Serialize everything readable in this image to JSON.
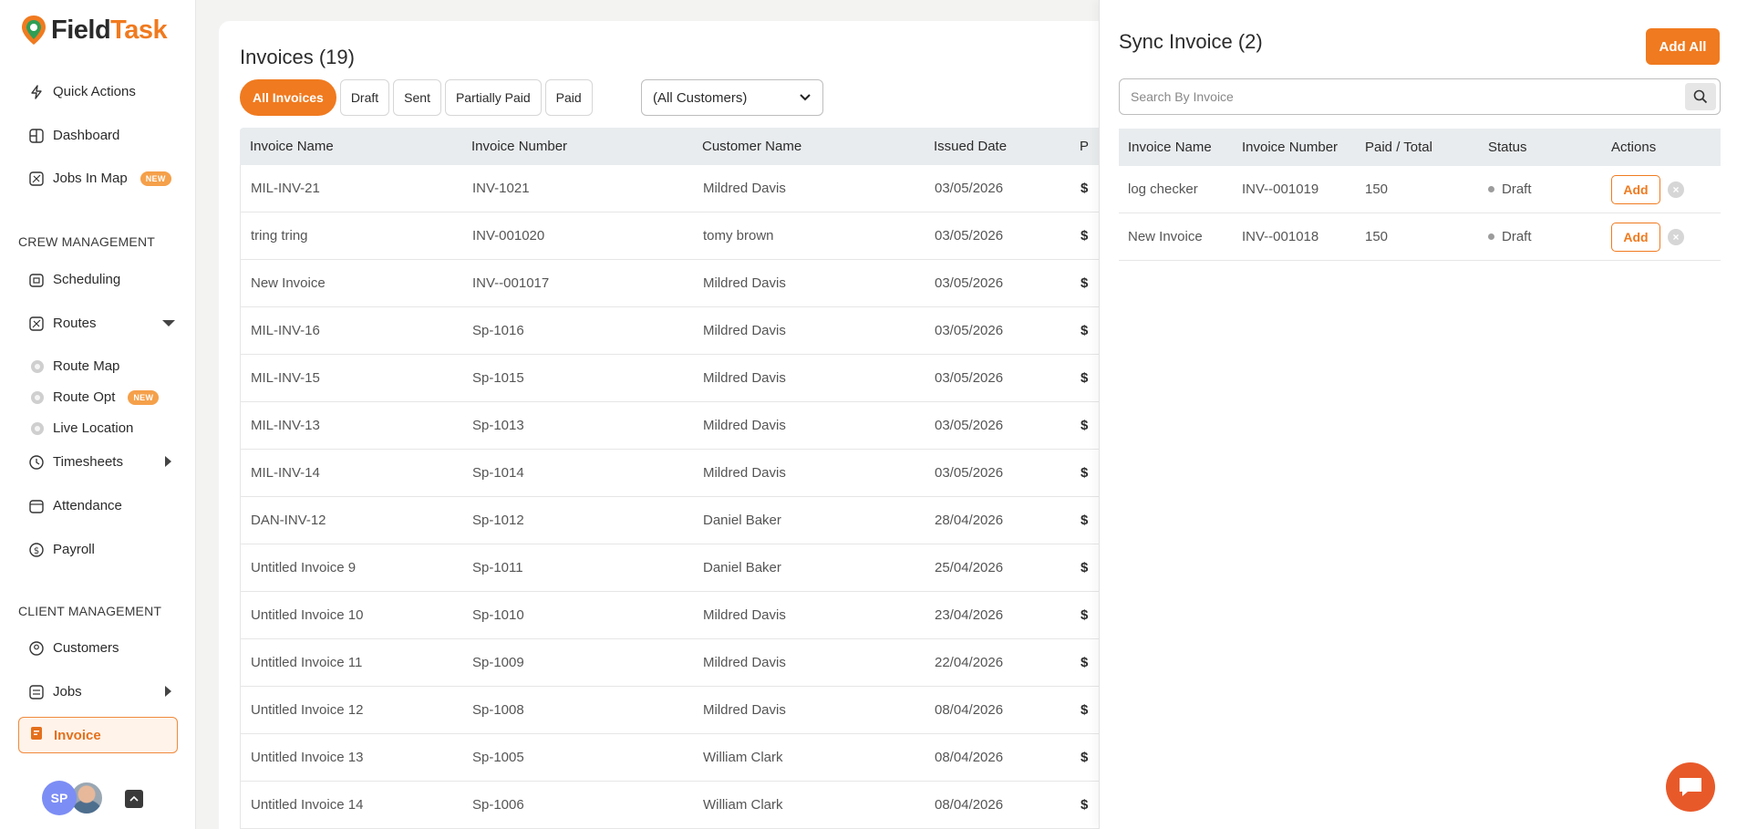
{
  "app": {
    "logo_part1": "Field",
    "logo_part2": "Task"
  },
  "sidebar": {
    "quick_actions": "Quick Actions",
    "dashboard": "Dashboard",
    "jobs_in_map": "Jobs In Map",
    "new_badge": "NEW",
    "crew_section": "CREW MANAGEMENT",
    "scheduling": "Scheduling",
    "routes": "Routes",
    "route_map": "Route Map",
    "route_opt": "Route Opt",
    "live_location": "Live Location",
    "timesheets": "Timesheets",
    "attendance": "Attendance",
    "payroll": "Payroll",
    "client_section": "CLIENT MANAGEMENT",
    "customers": "Customers",
    "jobs": "Jobs",
    "invoice": "Invoice",
    "avatar_initials": "SP"
  },
  "main": {
    "title": "Invoices (19)",
    "filters": [
      "All Invoices",
      "Draft",
      "Sent",
      "Partially Paid",
      "Paid"
    ],
    "customer_select": "(All Customers)",
    "columns": [
      "Invoice Name",
      "Invoice Number",
      "Customer Name",
      "Issued Date",
      "P"
    ],
    "rows": [
      {
        "name": "MIL-INV-21",
        "number": "INV-1021",
        "customer": "Mildred Davis",
        "date": "03/05/2026",
        "paid": "$"
      },
      {
        "name": "tring tring",
        "number": "INV-001020",
        "customer": "tomy brown",
        "date": "03/05/2026",
        "paid": "$"
      },
      {
        "name": "New Invoice",
        "number": "INV--001017",
        "customer": "Mildred Davis",
        "date": "03/05/2026",
        "paid": "$"
      },
      {
        "name": "MIL-INV-16",
        "number": "Sp-1016",
        "customer": "Mildred Davis",
        "date": "03/05/2026",
        "paid": "$"
      },
      {
        "name": "MIL-INV-15",
        "number": "Sp-1015",
        "customer": "Mildred Davis",
        "date": "03/05/2026",
        "paid": "$"
      },
      {
        "name": "MIL-INV-13",
        "number": "Sp-1013",
        "customer": "Mildred Davis",
        "date": "03/05/2026",
        "paid": "$"
      },
      {
        "name": "MIL-INV-14",
        "number": "Sp-1014",
        "customer": "Mildred Davis",
        "date": "03/05/2026",
        "paid": "$"
      },
      {
        "name": "DAN-INV-12",
        "number": "Sp-1012",
        "customer": "Daniel Baker",
        "date": "28/04/2026",
        "paid": "$"
      },
      {
        "name": "Untitled Invoice 9",
        "number": "Sp-1011",
        "customer": "Daniel Baker",
        "date": "25/04/2026",
        "paid": "$"
      },
      {
        "name": "Untitled Invoice 10",
        "number": "Sp-1010",
        "customer": "Mildred Davis",
        "date": "23/04/2026",
        "paid": "$"
      },
      {
        "name": "Untitled Invoice 11",
        "number": "Sp-1009",
        "customer": "Mildred Davis",
        "date": "22/04/2026",
        "paid": "$"
      },
      {
        "name": "Untitled Invoice 12",
        "number": "Sp-1008",
        "customer": "Mildred Davis",
        "date": "08/04/2026",
        "paid": "$"
      },
      {
        "name": "Untitled Invoice 13",
        "number": "Sp-1005",
        "customer": "William Clark",
        "date": "08/04/2026",
        "paid": "$"
      },
      {
        "name": "Untitled Invoice 14",
        "number": "Sp-1006",
        "customer": "William Clark",
        "date": "08/04/2026",
        "paid": "$"
      }
    ]
  },
  "sync": {
    "title": "Sync Invoice (2)",
    "add_all": "Add All",
    "search_placeholder": "Search By Invoice",
    "columns": [
      "Invoice Name",
      "Invoice Number",
      "Paid / Total",
      "Status",
      "Actions"
    ],
    "rows": [
      {
        "name": "log checker",
        "number": "INV--001019",
        "paid_total": "150",
        "status": "Draft",
        "action": "Add"
      },
      {
        "name": "New Invoice",
        "number": "INV--001018",
        "paid_total": "150",
        "status": "Draft",
        "action": "Add"
      }
    ]
  },
  "colors": {
    "accent": "#f07a1f",
    "chat": "#e8592a"
  }
}
